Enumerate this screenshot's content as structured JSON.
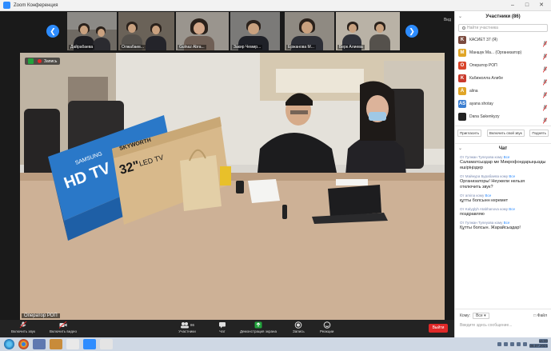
{
  "window": {
    "title": "Zoom Конференция"
  },
  "gallery": {
    "tiles": [
      {
        "name": "Дайрабаева"
      },
      {
        "name": "Олжабаев..."
      },
      {
        "name": "Gulnaz Abra..."
      },
      {
        "name": "Закир Чемир..."
      },
      {
        "name": "Ержанова М..."
      },
      {
        "name": "Берк Алиева"
      }
    ],
    "view_label": "Вид"
  },
  "video": {
    "recording_label": "Запись",
    "speaker_name": "Оператор РОП"
  },
  "toolbar": {
    "mute": "Включить звук",
    "video": "Включить видео",
    "participants": "Участники",
    "participants_count": "86",
    "chat": "Чат",
    "share": "Демонстрация экрана",
    "record": "Запись",
    "reactions": "Реакции",
    "end": "Выйти"
  },
  "panel": {
    "title": "Участники (86)",
    "search_placeholder": "Найти участника",
    "participants": [
      {
        "initial": "K",
        "color": "#7b4a3e",
        "name": "КАСИЕТ 37 (Я)"
      },
      {
        "initial": "M",
        "color": "#e0a526",
        "name": "Маншук Ма... (Организатор)"
      },
      {
        "initial": "O",
        "color": "#d9452b",
        "name": "Оператор РОП"
      },
      {
        "initial": "K",
        "color": "#c93a2c",
        "name": "Кабижолла Алибе"
      },
      {
        "initial": "A",
        "color": "#e0a526",
        "name": "alina"
      },
      {
        "initial": "AS",
        "color": "#3c7fd1",
        "name": "ayana shotay"
      },
      {
        "initial": "",
        "color": "#222222",
        "name": "Dana Sakenkyzy"
      }
    ],
    "actions": [
      "Пригласить",
      "Включить свой звук",
      "Поднять"
    ]
  },
  "chat": {
    "title": "Чат",
    "messages": [
      {
        "from": "От Гулжан Тулеуова кому",
        "to": "Все",
        "text": "Саламатсыздар ме Микрофондарыңызды өшіріңіздер"
      },
      {
        "from": "От Майнура Бурабаева кому",
        "to": "Все",
        "text": "Организаторы! Неужели нельзя отключить звук?"
      },
      {
        "from": "От amina кому",
        "to": "Все",
        "text": "құтты болсынн керемет"
      },
      {
        "from": "От Kalyglyh Atabhanova кому",
        "to": "Все",
        "text": "поздравляю"
      },
      {
        "from": "От Гулжан Тулеуова кому",
        "to": "Все",
        "text": "Құтты болсын. Жарайсыздар!"
      }
    ],
    "to_label": "Кому:",
    "to_value": "Все",
    "file_label": "Файл",
    "input_placeholder": "Введите здесь сообщение..."
  },
  "taskbar": {
    "clock_time": "16:00",
    "clock_date": "06.07.2021"
  }
}
